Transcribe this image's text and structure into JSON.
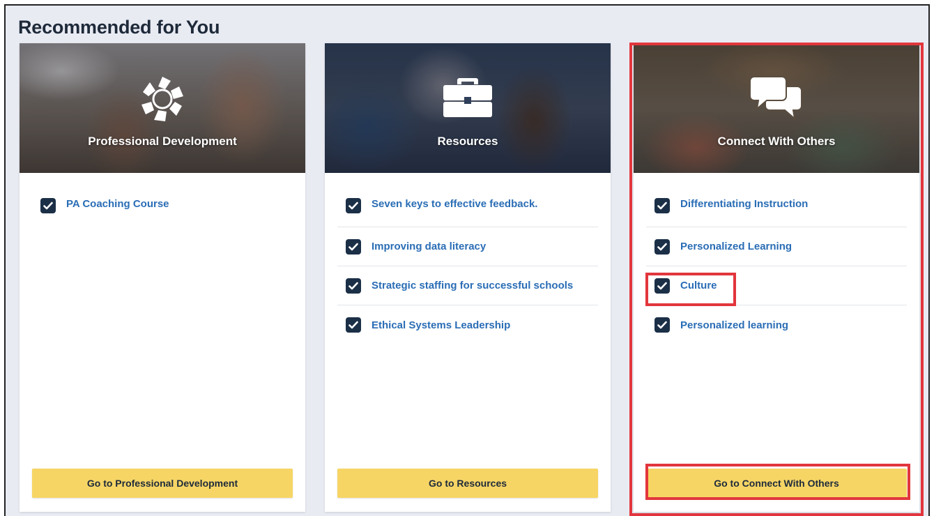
{
  "section": {
    "title": "Recommended for You"
  },
  "cards": [
    {
      "title": "Professional Development",
      "icon": "aperture-icon",
      "items": [
        "PA Coaching Course"
      ],
      "button": "Go to Professional Development"
    },
    {
      "title": "Resources",
      "icon": "briefcase-icon",
      "items": [
        "Seven keys to effective feedback.",
        "Improving data literacy",
        "Strategic staffing for successful schools",
        "Ethical Systems Leadership"
      ],
      "button": "Go to Resources"
    },
    {
      "title": "Connect With Others",
      "icon": "chat-bubbles-icon",
      "items": [
        "Differentiating Instruction",
        "Personalized Learning",
        "Culture",
        "Personalized learning"
      ],
      "button": "Go to Connect With Others"
    }
  ],
  "colors": {
    "checkbox": "#1b2f47",
    "link": "#2a6db5",
    "button": "#f6d565",
    "highlight": "#e2363d",
    "background": "#e9ebf3"
  }
}
